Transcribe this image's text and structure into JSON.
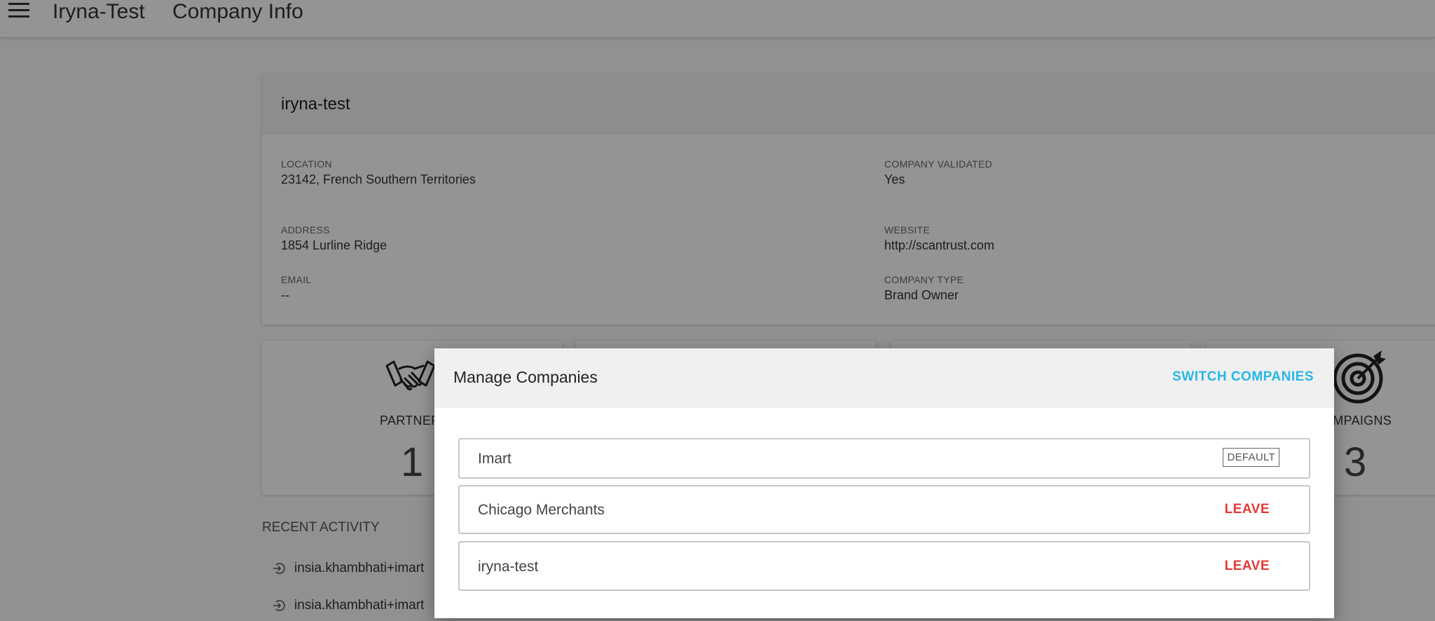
{
  "appbar": {
    "app_title": "Iryna-Test",
    "page_title": "Company Info"
  },
  "company": {
    "name": "iryna-test",
    "fields": {
      "location": {
        "label": "LOCATION",
        "value": "23142, French Southern Territories"
      },
      "company_validated": {
        "label": "COMPANY VALIDATED",
        "value": "Yes"
      },
      "address": {
        "label": "ADDRESS",
        "value": "1854 Lurline Ridge"
      },
      "website": {
        "label": "WEBSITE",
        "value": "http://scantrust.com"
      },
      "email": {
        "label": "EMAIL",
        "value": "--"
      },
      "company_type": {
        "label": "COMPANY TYPE",
        "value": "Brand Owner"
      }
    }
  },
  "stats": {
    "partners": {
      "label": "PARTNER",
      "value": "1",
      "icon": "handshake-icon"
    },
    "campaigns": {
      "label": "AMPAIGNS",
      "value": "3",
      "icon": "target-icon"
    }
  },
  "recent_activity": {
    "title": "RECENT ACTIVITY",
    "items": [
      {
        "text": "insia.khambhati+imart"
      },
      {
        "text": "insia.khambhati+imart"
      }
    ]
  },
  "dialog": {
    "title": "Manage Companies",
    "switch_label": "SWITCH COMPANIES",
    "companies": [
      {
        "name": "Imart",
        "badge": "DEFAULT"
      },
      {
        "name": "Chicago Merchants",
        "action": "LEAVE"
      },
      {
        "name": "iryna-test",
        "action": "LEAVE"
      }
    ]
  },
  "colors": {
    "accent": "#29b6e8",
    "danger": "#e53935",
    "overlay": "rgba(0,0,0,0.42)"
  }
}
